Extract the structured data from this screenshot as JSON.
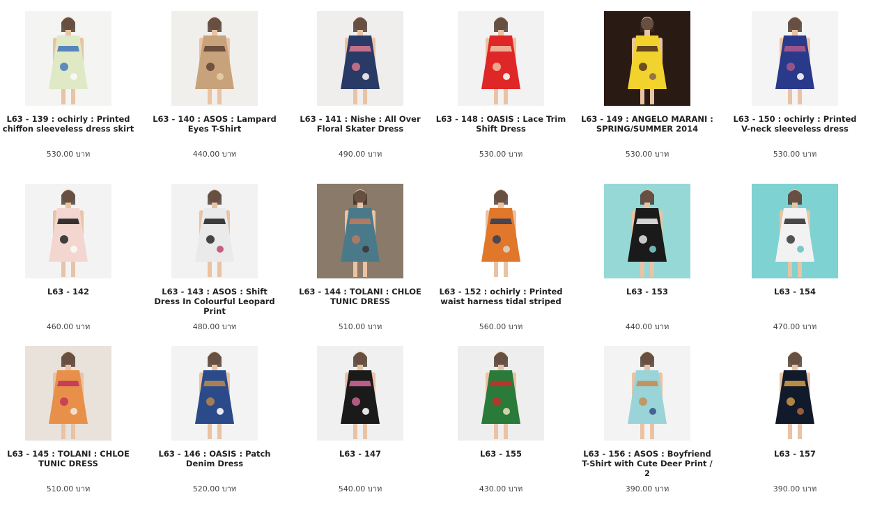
{
  "products": [
    {
      "title": "L63 - 139 : ochirly : Printed chiffon sleeveless dress skirt",
      "price": "530.00 บาท",
      "image": "sleeveless-print-dress-photo",
      "bg": "#f4f4f2",
      "colors": [
        "#dfe9c6",
        "#3f73b8",
        "#fafafa"
      ]
    },
    {
      "title": "L63 - 140 : ASOS : Lampard Eyes T-Shirt",
      "price": "440.00 บาท",
      "image": "leopard-tshirt-photo",
      "bg": "#f1efec",
      "colors": [
        "#c8a27a",
        "#5a4030",
        "#e4cfa8"
      ]
    },
    {
      "title": "L63 - 141 : Nishe : All Over Floral Skater Dress",
      "price": "490.00 บาท",
      "image": "floral-skater-dress-photo",
      "bg": "#f0eeec",
      "colors": [
        "#2a3a66",
        "#e07a8f",
        "#f4f1ee"
      ]
    },
    {
      "title": "L63 - 148 : OASIS : Lace Trim Shift Dress",
      "price": "530.00 บาท",
      "image": "red-shift-dress-photo",
      "bg": "#f2f2f2",
      "colors": [
        "#e02727",
        "#f0c7a8",
        "#fbfbfb"
      ]
    },
    {
      "title": "L63 - 149 : ANGELO MARANI : SPRING/SUMMER 2014",
      "price": "530.00 บาท",
      "image": "runway-yellow-dress-photo",
      "bg": "#2a1a14",
      "colors": [
        "#f2d22c",
        "#4a2c1c",
        "#8a6a4a"
      ]
    },
    {
      "title": "L63 - 150 : ochirly : Printed V-neck sleeveless dress",
      "price": "530.00 บาท",
      "image": "printed-vneck-dress-photo",
      "bg": "#f4f4f4",
      "colors": [
        "#2a3a8a",
        "#b05a8a",
        "#fafafa"
      ]
    },
    {
      "title": "L63 - 142",
      "price": "460.00 บาท",
      "image": "pink-black-dress-photo",
      "bg": "#f3f3f3",
      "colors": [
        "#f4d6d0",
        "#151515",
        "#fafafa"
      ]
    },
    {
      "title": "L63 - 143 : ASOS : Shift Dress In Colourful Leopard Print",
      "price": "480.00 บาท",
      "image": "leopard-shift-dress-photo",
      "bg": "#f2f2f2",
      "colors": [
        "#eaeaea",
        "#1c1c1c",
        "#c0507a"
      ]
    },
    {
      "title": "L63 - 144 : TOLANI : CHLOE TUNIC DRESS",
      "price": "510.00 บาท",
      "image": "street-tunic-dress-photo",
      "bg": "#8a7a6a",
      "colors": [
        "#4a7a8a",
        "#c47a5a",
        "#3a3a3a"
      ]
    },
    {
      "title": "L63 - 152 : ochirly : Printed waist harness tidal striped",
      "price": "560.00 บาท",
      "image": "striped-strap-dress-photo",
      "bg": "#ffffff",
      "colors": [
        "#e0772a",
        "#2a3a5a",
        "#d8d2c6"
      ]
    },
    {
      "title": "L63 - 153",
      "price": "440.00 บาท",
      "image": "striped-top-photo",
      "bg": "#96d8d6",
      "colors": [
        "#1a1a1a",
        "#f4f4f4",
        "#7ac6c4"
      ]
    },
    {
      "title": "L63 - 154",
      "price": "470.00 บาท",
      "image": "diamond-print-shirt-photo",
      "bg": "#7fd2d2",
      "colors": [
        "#f2f2f2",
        "#2a2a2a",
        "#6cc4c4"
      ]
    },
    {
      "title": "L63 - 145 : TOLANI : CHLOE TUNIC DRESS",
      "price": "510.00 บาท",
      "image": "orange-tunic-dress-photo",
      "bg": "#e8e2da",
      "colors": [
        "#e8904a",
        "#c0305a",
        "#f2e8da"
      ]
    },
    {
      "title": "L63 - 146 : OASIS : Patch Denim Dress",
      "price": "520.00 บาท",
      "image": "denim-dress-photo",
      "bg": "#f3f3f3",
      "colors": [
        "#2a4a8a",
        "#c08a4a",
        "#fafafa"
      ]
    },
    {
      "title": "L63 - 147",
      "price": "540.00 บาท",
      "image": "sequin-shift-dress-photo",
      "bg": "#f0f0f0",
      "colors": [
        "#1a1a1a",
        "#d86a9a",
        "#fafafa"
      ]
    },
    {
      "title": "L63 - 155",
      "price": "430.00 บาท",
      "image": "stripe-panel-blouse-photo",
      "bg": "#eeeeee",
      "colors": [
        "#2a7a3a",
        "#d02a2a",
        "#e8d8b8"
      ]
    },
    {
      "title": "L63 - 156 : ASOS : Boyfriend T-Shirt with Cute Deer Print / 2",
      "price": "390.00 บาท",
      "image": "deer-print-tshirt-photo",
      "bg": "#f3f3f3",
      "colors": [
        "#9ad4d8",
        "#c88a4a",
        "#3a5a8a"
      ]
    },
    {
      "title": "L63 - 157",
      "price": "390.00 บาท",
      "image": "leopard-print-tank-photo",
      "bg": "#ffffff",
      "colors": [
        "#111a2a",
        "#d8a04a",
        "#a8643a"
      ]
    }
  ]
}
